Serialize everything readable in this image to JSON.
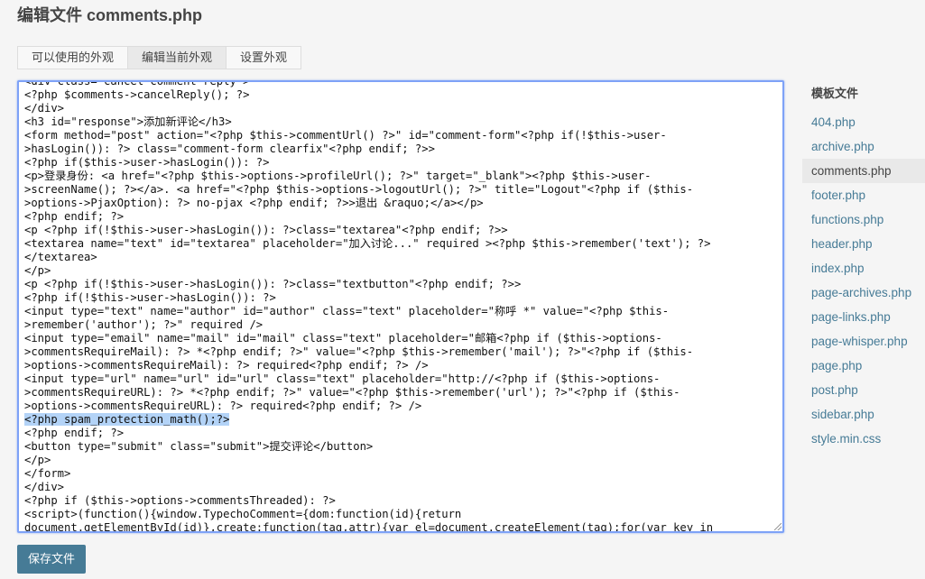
{
  "page": {
    "title": "编辑文件 comments.php"
  },
  "tabs": [
    {
      "label": "可以使用的外观"
    },
    {
      "label": "编辑当前外观"
    },
    {
      "label": "设置外观"
    }
  ],
  "editor": {
    "lines": [
      "<div class=\"cancel-comment-reply\">",
      "<?php $comments->cancelReply(); ?>",
      "</div>",
      "<h3 id=\"response\">添加新评论</h3>",
      "<form method=\"post\" action=\"<?php $this->commentUrl() ?>\" id=\"comment-form\"<?php if(!$this->user-",
      ">hasLogin()): ?> class=\"comment-form clearfix\"<?php endif; ?>>",
      "<?php if($this->user->hasLogin()): ?>",
      "<p>登录身份: <a href=\"<?php $this->options->profileUrl(); ?>\" target=\"_blank\"><?php $this->user-",
      ">screenName(); ?></a>. <a href=\"<?php $this->options->logoutUrl(); ?>\" title=\"Logout\"<?php if ($this-",
      ">options->PjaxOption): ?> no-pjax <?php endif; ?>>退出 &raquo;</a></p>",
      "<?php endif; ?>",
      "<p <?php if(!$this->user->hasLogin()): ?>class=\"textarea\"<?php endif; ?>>",
      "<textarea name=\"text\" id=\"textarea\" placeholder=\"加入讨论...\" required ><?php $this->remember('text'); ?>",
      "</textarea>",
      "</p>",
      "<p <?php if(!$this->user->hasLogin()): ?>class=\"textbutton\"<?php endif; ?>>",
      "<?php if(!$this->user->hasLogin()): ?>",
      "<input type=\"text\" name=\"author\" id=\"author\" class=\"text\" placeholder=\"称呼 *\" value=\"<?php $this-",
      ">remember('author'); ?>\" required />",
      "<input type=\"email\" name=\"mail\" id=\"mail\" class=\"text\" placeholder=\"邮箱<?php if ($this->options-",
      ">commentsRequireMail): ?> *<?php endif; ?>\" value=\"<?php $this->remember('mail'); ?>\"<?php if ($this-",
      ">options->commentsRequireMail): ?> required<?php endif; ?> />",
      "<input type=\"url\" name=\"url\" id=\"url\" class=\"text\" placeholder=\"http://<?php if ($this->options-",
      ">commentsRequireURL): ?> *<?php endif; ?>\" value=\"<?php $this->remember('url'); ?>\"<?php if ($this-",
      ">options->commentsRequireURL): ?> required<?php endif; ?> />",
      "<?php spam_protection_math();?>",
      "<?php endif; ?>",
      "<button type=\"submit\" class=\"submit\">提交评论</button>",
      "</p>",
      "</form>",
      "</div>",
      "<?php if ($this->options->commentsThreaded): ?>",
      "<script>(function(){window.TypechoComment={dom:function(id){return",
      "document.getElementById(id)},create:function(tag,attr){var el=document.createElement(tag);for(var key in"
    ],
    "selected_line": 25
  },
  "save_button": {
    "label": "保存文件"
  },
  "sidebar": {
    "heading": "模板文件",
    "current": "comments.php",
    "files": [
      "404.php",
      "archive.php",
      "comments.php",
      "footer.php",
      "functions.php",
      "header.php",
      "index.php",
      "page-archives.php",
      "page-links.php",
      "page-whisper.php",
      "page.php",
      "post.php",
      "sidebar.php",
      "style.min.css"
    ]
  },
  "colors": {
    "accent": "#467b96",
    "editor_focus_border": "#7ea2f7",
    "selection": "#b3d3f7"
  }
}
